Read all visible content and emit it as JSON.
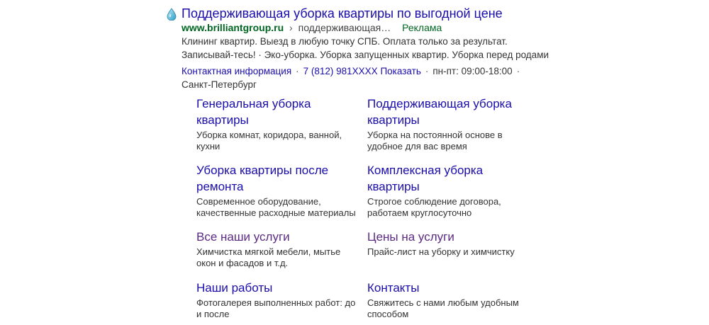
{
  "ad": {
    "title": "Поддерживающая уборка квартиры по выгодной цене",
    "domain": "www.brilliantgroup.ru",
    "separator": "›",
    "path": "поддерживающая…",
    "ad_label": "Реклама",
    "description": "Клининг квартир. Выезд в любую точку СПБ. Оплата только за результат. Записывай-тесь! · Эко-уборка. Уборка запущенных квартир. Уборка перед родами",
    "contact_link": "Контактная информация",
    "dot": "·",
    "phone": "7 (812) 981XXXX",
    "show_label": "Показать",
    "hours": "пн-пт: 09:00-18:00",
    "city": "Санкт-Петербург",
    "favicon_icon": "water-drop-icon",
    "colors": {
      "title": "#1a0dab",
      "domain": "#006621",
      "visited": "#5b2a82"
    }
  },
  "sitelinks": [
    {
      "title": "Генеральная уборка квартиры",
      "desc": "Уборка комнат, коридора, ванной, кухни"
    },
    {
      "title": "Поддерживающая уборка квартиры",
      "desc": "Уборка на постоянной основе в удобное для вас время"
    },
    {
      "title": "Уборка квартиры после ремонта",
      "desc": "Современное оборудование, качественные расходные материалы"
    },
    {
      "title": "Комплексная уборка квартиры",
      "desc": "Строгое соблюдение договора, работаем круглосуточно"
    },
    {
      "title": "Все наши услуги",
      "desc": "Химчистка мягкой мебели, мытье окон и фасадов и т.д."
    },
    {
      "title": "Цены на услуги",
      "desc": "Прайс-лист на уборку и химчистку"
    },
    {
      "title": "Наши работы",
      "desc": "Фотогалерея выполненных работ: до и после"
    },
    {
      "title": "Контакты",
      "desc": "Свяжитесь с нами любым удобным способом"
    }
  ]
}
